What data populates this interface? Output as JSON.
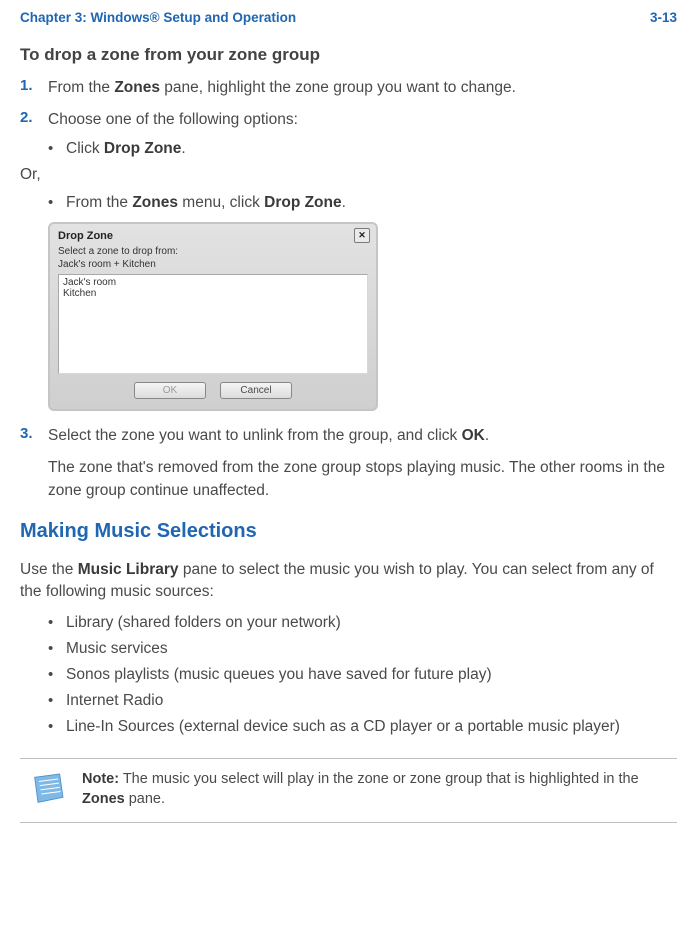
{
  "header": {
    "left": "Chapter 3:  Windows® Setup and Operation",
    "right": "3-13"
  },
  "section1": {
    "title": "To drop a zone from your zone group",
    "step1_num": "1.",
    "step1_text_a": "From the ",
    "step1_text_b": "Zones",
    "step1_text_c": " pane, highlight the zone group you want to change.",
    "step2_num": "2.",
    "step2_text": "Choose one of the following options:",
    "bullet1_a": "Click ",
    "bullet1_b": "Drop Zone",
    "bullet1_c": ".",
    "or": "Or,",
    "bullet2_a": "From the ",
    "bullet2_b": "Zones",
    "bullet2_c": " menu, click ",
    "bullet2_d": "Drop Zone",
    "bullet2_e": "."
  },
  "dialog": {
    "title": "Drop Zone",
    "label": "Select a zone to drop from:",
    "sublabel": "Jack's room + Kitchen",
    "items": [
      "Jack's room",
      "Kitchen"
    ],
    "ok": "OK",
    "cancel": "Cancel"
  },
  "step3": {
    "num": "3.",
    "text_a": "Select the zone you want to unlink from the group, and click ",
    "text_b": "OK",
    "text_c": ".",
    "after": "The zone that's removed from the zone group stops playing music. The other rooms in the zone group continue unaffected."
  },
  "section2": {
    "heading": "Making Music Selections",
    "intro_a": "Use the ",
    "intro_b": "Music Library",
    "intro_c": " pane to select the music you wish to play. You can select from any of the following music sources:",
    "sources": [
      "Library (shared folders on your network)",
      "Music services",
      "Sonos playlists (music queues you have saved for future play)",
      "Internet Radio",
      "Line-In Sources (external device such as a CD player or a portable music player)"
    ]
  },
  "note": {
    "label": "Note:",
    "text_a": "   The music you select will play in the zone or zone group that is highlighted in the ",
    "text_b": "Zones",
    "text_c": " pane."
  }
}
